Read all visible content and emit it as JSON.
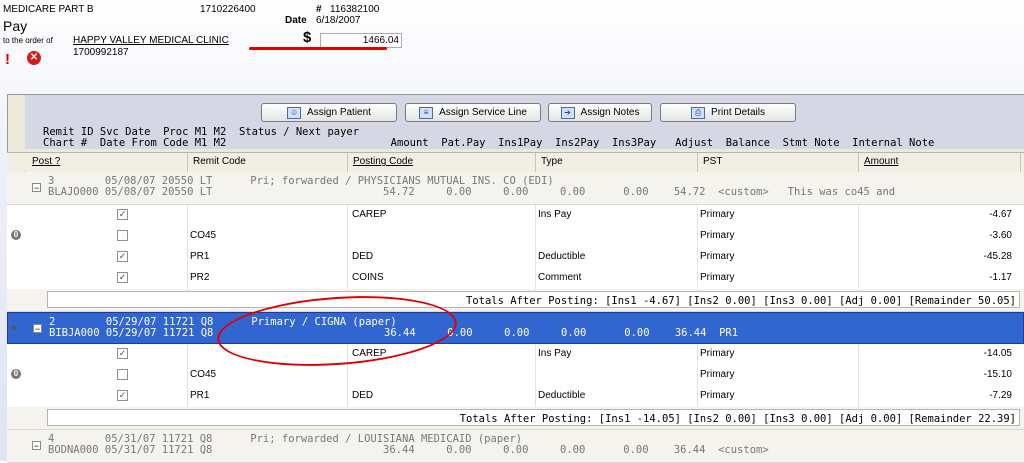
{
  "check": {
    "payer": "MEDICARE PART B",
    "payer_id": "1710226400",
    "pay_label": "Pay",
    "order_label": "to the order of",
    "payee_name": "HAPPY VALLEY MEDICAL CLINIC",
    "payee_id": "1700992187",
    "number_label": "#",
    "number": "116382100",
    "date_label": "Date",
    "date": "6/18/2007",
    "dollar_label": "$",
    "amount": "1466.04",
    "warning_symbol": "!",
    "error_symbol": "✕"
  },
  "toolbar": {
    "assign_patient": "Assign Patient",
    "assign_service_line": "Assign Service Line",
    "assign_notes": "Assign Notes",
    "print_details": "Print Details"
  },
  "legend": {
    "line1": "Remit ID Svc Date  Proc M1 M2  Status / Next payer",
    "line2": "Chart #  Date From Code M1 M2                          Amount  Pat.Pay  Ins1Pay  Ins2Pay  Ins3Pay   Adjust  Balance  Stmt Note  Internal Note"
  },
  "columns": {
    "post": "Post ?",
    "remit_code": "Remit Code",
    "posting_code": "Posting Code",
    "type": "Type",
    "pst": "PST",
    "amount": "Amount"
  },
  "groups": [
    {
      "expander": "−",
      "line1": "3        05/08/07 20550 LT      Pri; forwarded / PHYSICIANS MUTUAL INS. CO (EDI)",
      "line2": "BLAJO000 05/08/07 20550 LT                           54.72     0.00     0.00     0.00      0.00    54.72  <custom>   This was co45 and",
      "lines": [
        {
          "checked": "✓",
          "remit": "",
          "posting": "CAREP",
          "type": "Ins Pay",
          "pst": "Primary",
          "amount": "-4.67"
        },
        {
          "checked": "",
          "remit": "CO45",
          "posting": "",
          "type": "",
          "pst": "Primary",
          "amount": "-3.60"
        },
        {
          "checked": "✓",
          "remit": "PR1",
          "posting": "DED",
          "type": "Deductible",
          "pst": "Primary",
          "amount": "-45.28"
        },
        {
          "checked": "✓",
          "remit": "PR2",
          "posting": "COINS",
          "type": "Comment",
          "pst": "Primary",
          "amount": "-1.17"
        }
      ],
      "totals": "Totals After Posting: [Ins1 -4.67] [Ins2 0.00] [Ins3 0.00] [Adj 0.00] [Remainder 50.05]"
    },
    {
      "expander": "−",
      "line1": "2        05/29/07 11721 Q8      Primary / CIGNA (paper)",
      "line2": "BIBJA000 05/29/07 11721 Q8                           36.44     0.00     0.00     0.00      0.00    36.44  PR1",
      "lines": [
        {
          "checked": "✓",
          "remit": "",
          "posting": "CAREP",
          "type": "Ins Pay",
          "pst": "Primary",
          "amount": "-14.05"
        },
        {
          "checked": "",
          "remit": "CO45",
          "posting": "",
          "type": "",
          "pst": "Primary",
          "amount": "-15.10"
        },
        {
          "checked": "✓",
          "remit": "PR1",
          "posting": "DED",
          "type": "Deductible",
          "pst": "Primary",
          "amount": "-7.29"
        }
      ],
      "totals": "Totals After Posting: [Ins1 -14.05] [Ins2 0.00] [Ins3 0.00] [Adj 0.00] [Remainder 22.39]"
    },
    {
      "expander": "−",
      "line1": "4        05/31/07 11721 Q8      Pri; forwarded / LOUISIANA MEDICAID (paper)",
      "line2": "BODNA000 05/31/07 11721 Q8                           36.44     0.00     0.00     0.00      0.00    36.44  <custom>"
    }
  ],
  "colors": {
    "selected_row": "#3165d0",
    "annotation_red": "#e00000"
  }
}
